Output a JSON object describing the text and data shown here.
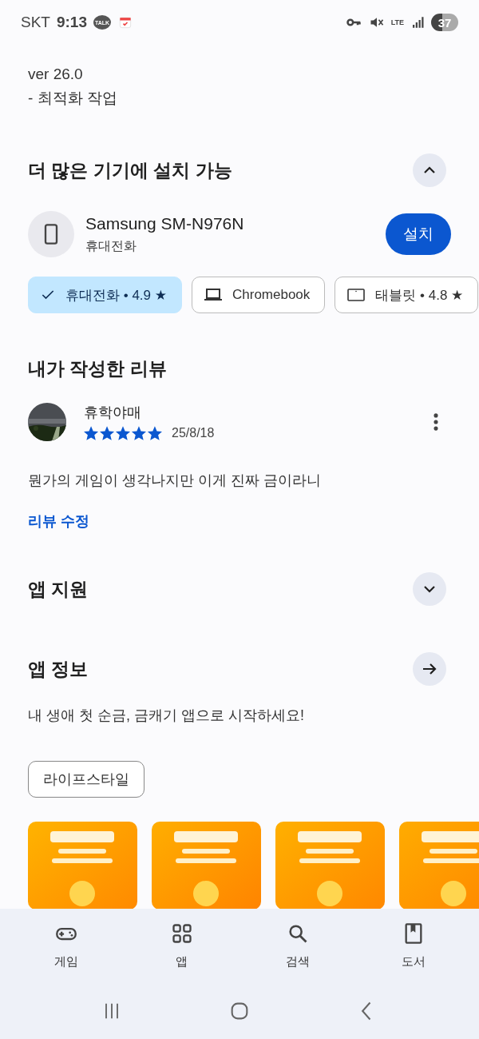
{
  "status_bar": {
    "carrier": "SKT",
    "time": "9:13",
    "talk_badge": "TALK",
    "network": "LTE",
    "battery": "37"
  },
  "whats_new": {
    "lines": [
      "ver 26.0",
      "- 최적화 작업"
    ]
  },
  "install_more": {
    "title": "더 많은 기기에 설치 가능",
    "expanded": true,
    "device_name": "Samsung SM-N976N",
    "device_type": "휴대전화",
    "install_button": "설치",
    "devices": [
      {
        "kind": "phone",
        "label": "휴대전화 • 4.9 ★",
        "selected": true
      },
      {
        "kind": "laptop",
        "label": "Chromebook",
        "selected": false
      },
      {
        "kind": "tablet",
        "label": "태블릿 • 4.8 ★",
        "selected": false
      }
    ]
  },
  "my_review": {
    "title": "내가 작성한 리뷰",
    "author": "휴학야매",
    "stars": 5,
    "date": "25/8/18",
    "text": "뭔가의 게임이 생각나지만 이게 진짜 금이라니",
    "edit_link": "리뷰 수정"
  },
  "app_support": {
    "title": "앱 지원",
    "expanded": false
  },
  "app_info": {
    "title": "앱 정보",
    "description": "내 생애 첫 순금, 금캐기 앱으로 시작하세요!"
  },
  "tags": [
    "라이프스타일"
  ],
  "screenshots": [
    {
      "kind": "picture"
    },
    {
      "kind": "picture"
    },
    {
      "kind": "picture"
    },
    {
      "kind": "picture"
    }
  ],
  "bottom_nav": [
    {
      "kind": "games",
      "label": "게임"
    },
    {
      "kind": "apps",
      "label": "앱"
    },
    {
      "kind": "search",
      "label": "검색"
    },
    {
      "kind": "books",
      "label": "도서"
    }
  ]
}
